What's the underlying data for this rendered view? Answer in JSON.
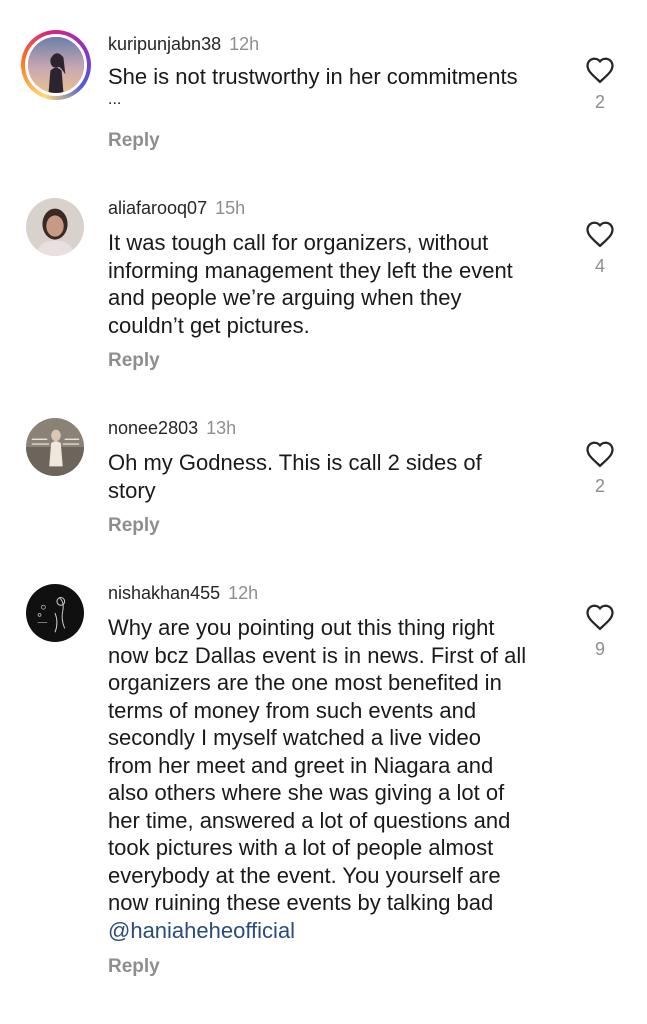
{
  "comments": [
    {
      "username": "kuripunjabn38",
      "time": "12h",
      "text_lines": [
        "She is not trustworthy in her commitments",
        "..."
      ],
      "likes": "2",
      "reply": "Reply",
      "avatar": "sunset-silhouette-avatar"
    },
    {
      "username": "aliafarooq07",
      "time": "15h",
      "text_lines": [
        "It was tough call for organizers, without",
        "informing management they left the event",
        "and people we’re arguing when they",
        "couldn’t get pictures."
      ],
      "likes": "4",
      "reply": "Reply",
      "avatar": "woman-portrait-avatar"
    },
    {
      "username": "nonee2803",
      "time": "13h",
      "text_lines": [
        "Oh my Godness. This is call 2 sides of",
        "story"
      ],
      "likes": "2",
      "reply": "Reply",
      "avatar": "text-overlay-photo-avatar"
    },
    {
      "username": "nishakhan455",
      "time": "12h",
      "text_lines": [
        "Why are you pointing out this thing right",
        "now bcz Dallas event is in news. First of all",
        "organizers are the one most benefited in",
        "terms of money from such events and",
        "secondly I myself watched a live video",
        "from her meet and greet in Niagara and",
        "also others where she was giving a lot of",
        "her time, answered a lot of questions and",
        "took pictures with a lot of people almost",
        "everybody at the event. You yourself are",
        "now ruining these events by talking bad"
      ],
      "mention": "@haniaheheofficial",
      "likes": "9",
      "reply": "Reply",
      "avatar": "dark-sketch-avatar"
    }
  ],
  "colors": {
    "text": "#1a1a1a",
    "secondary": "#8e8e8e",
    "mention": "#2a4b7c"
  },
  "icons": {
    "like": "heart-outline-icon"
  }
}
